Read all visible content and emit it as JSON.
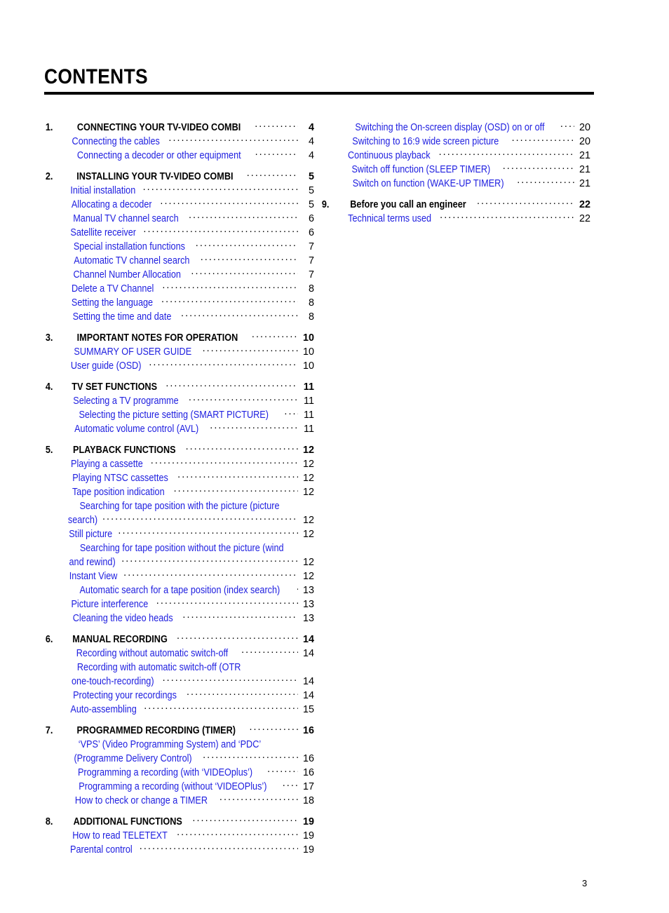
{
  "document": {
    "title": "CONTENTS",
    "folio": "3"
  },
  "columns": {
    "left": [
      {
        "number": "1.",
        "heading": {
          "label": "CONNECTING YOUR TV-VIDEO COMBI",
          "page": "4"
        },
        "entries": [
          {
            "lines": [
              "Connecting the cables"
            ],
            "page": "4"
          },
          {
            "lines": [
              "Connecting a decoder or other equipment"
            ],
            "page": "4"
          }
        ]
      },
      {
        "number": "2.",
        "heading": {
          "label": "INSTALLING YOUR TV-VIDEO COMBI",
          "page": "5"
        },
        "entries": [
          {
            "lines": [
              "Initial installation"
            ],
            "page": "5"
          },
          {
            "lines": [
              "Allocating a decoder"
            ],
            "page": "5"
          },
          {
            "lines": [
              "Manual TV channel search"
            ],
            "page": "6"
          },
          {
            "lines": [
              "Satellite receiver"
            ],
            "page": "6"
          },
          {
            "lines": [
              "Special installation functions"
            ],
            "page": "7"
          },
          {
            "lines": [
              "Automatic TV channel search"
            ],
            "page": "7"
          },
          {
            "lines": [
              "Channel Number Allocation"
            ],
            "page": "7"
          },
          {
            "lines": [
              "Delete a TV Channel"
            ],
            "page": "8"
          },
          {
            "lines": [
              "Setting the language"
            ],
            "page": "8"
          },
          {
            "lines": [
              "Setting the time and date"
            ],
            "page": "8"
          }
        ]
      },
      {
        "number": "3.",
        "heading": {
          "label": "IMPORTANT NOTES FOR OPERATION",
          "page": "10"
        },
        "entries": [
          {
            "lines": [
              "SUMMARY OF USER GUIDE"
            ],
            "page": "10"
          },
          {
            "lines": [
              "User guide (OSD)"
            ],
            "page": "10"
          }
        ]
      },
      {
        "number": "4.",
        "heading": {
          "label": "TV SET FUNCTIONS",
          "page": "11"
        },
        "entries": [
          {
            "lines": [
              "Selecting a TV programme"
            ],
            "page": "11"
          },
          {
            "lines": [
              "Selecting the picture setting (SMART PICTURE)"
            ],
            "page": "11"
          },
          {
            "lines": [
              "Automatic volume control (AVL)"
            ],
            "page": "11"
          }
        ]
      },
      {
        "number": "5.",
        "heading": {
          "label": "PLAYBACK FUNCTIONS",
          "page": "12"
        },
        "entries": [
          {
            "lines": [
              "Playing a cassette"
            ],
            "page": "12"
          },
          {
            "lines": [
              "Playing NTSC cassettes"
            ],
            "page": "12"
          },
          {
            "lines": [
              "Tape position indication"
            ],
            "page": "12"
          },
          {
            "lines": [
              "Searching for tape position with the picture (picture",
              "search)"
            ],
            "page": "12"
          },
          {
            "lines": [
              "Still picture"
            ],
            "page": "12"
          },
          {
            "lines": [
              "Searching for tape position without the picture (wind",
              "and rewind)"
            ],
            "page": "12"
          },
          {
            "lines": [
              "Instant View"
            ],
            "page": "12"
          },
          {
            "lines": [
              "Automatic search for a tape position (index search)"
            ],
            "page": "13"
          },
          {
            "lines": [
              "Picture interference"
            ],
            "page": "13"
          },
          {
            "lines": [
              "Cleaning the video heads"
            ],
            "page": "13"
          }
        ]
      },
      {
        "number": "6.",
        "heading": {
          "label": "MANUAL RECORDING",
          "page": "14"
        },
        "entries": [
          {
            "lines": [
              "Recording without automatic switch-off"
            ],
            "page": "14"
          },
          {
            "lines": [
              "Recording with automatic switch-off (OTR",
              "one-touch-recording)"
            ],
            "page": "14"
          },
          {
            "lines": [
              "Protecting your recordings"
            ],
            "page": "14"
          },
          {
            "lines": [
              "Auto-assembling"
            ],
            "page": "15"
          }
        ]
      },
      {
        "number": "7.",
        "heading": {
          "label": "PROGRAMMED RECORDING (TIMER)",
          "page": "16"
        },
        "entries": [
          {
            "lines": [
              "‘VPS’ (Video Programming System) and ‘PDC’",
              "(Programme Delivery Control)"
            ],
            "page": "16"
          },
          {
            "lines": [
              "Programming a recording (with ‘VIDEOplus’)"
            ],
            "page": "16"
          },
          {
            "lines": [
              "Programming a recording (without ‘VIDEOPlus’)"
            ],
            "page": "17"
          },
          {
            "lines": [
              "How to check or change a TIMER"
            ],
            "page": "18"
          }
        ]
      },
      {
        "number": "8.",
        "heading": {
          "label": "ADDITIONAL FUNCTIONS",
          "page": "19"
        },
        "entries": [
          {
            "lines": [
              "How to read TELETEXT"
            ],
            "page": "19"
          },
          {
            "lines": [
              "Parental control"
            ],
            "page": "19"
          }
        ]
      }
    ],
    "right": [
      {
        "number": "",
        "heading": null,
        "entries": [
          {
            "lines": [
              "Switching the On-screen display (OSD) on or off"
            ],
            "page": "20"
          },
          {
            "lines": [
              "Switching to 16:9 wide screen picture"
            ],
            "page": "20"
          },
          {
            "lines": [
              "Continuous playback"
            ],
            "page": "21"
          },
          {
            "lines": [
              "Switch off function (SLEEP TIMER)"
            ],
            "page": "21"
          },
          {
            "lines": [
              "Switch on function (WAKE-UP TIMER)"
            ],
            "page": "21"
          }
        ]
      },
      {
        "number": "9.",
        "heading": {
          "label": "Before you call an engineer",
          "page": "22"
        },
        "entries": [
          {
            "lines": [
              "Technical terms used"
            ],
            "page": "22"
          }
        ]
      }
    ]
  }
}
